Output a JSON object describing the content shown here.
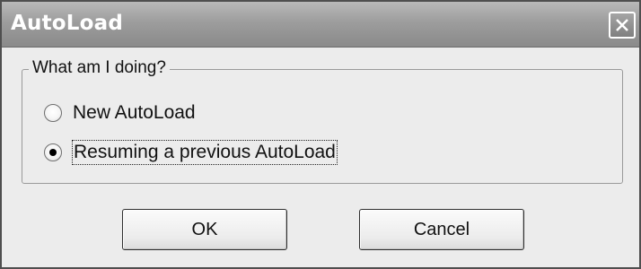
{
  "window": {
    "title": "AutoLoad",
    "close_icon": "close-icon"
  },
  "group": {
    "legend": "What am I doing?",
    "options": [
      {
        "label": "New AutoLoad",
        "selected": false
      },
      {
        "label": "Resuming a previous AutoLoad",
        "selected": true
      }
    ]
  },
  "buttons": {
    "ok_label": "OK",
    "cancel_label": "Cancel"
  },
  "colors": {
    "titlebar": "#9d9d9d",
    "dialog_background": "#ececec",
    "title_text": "#ffffff"
  }
}
